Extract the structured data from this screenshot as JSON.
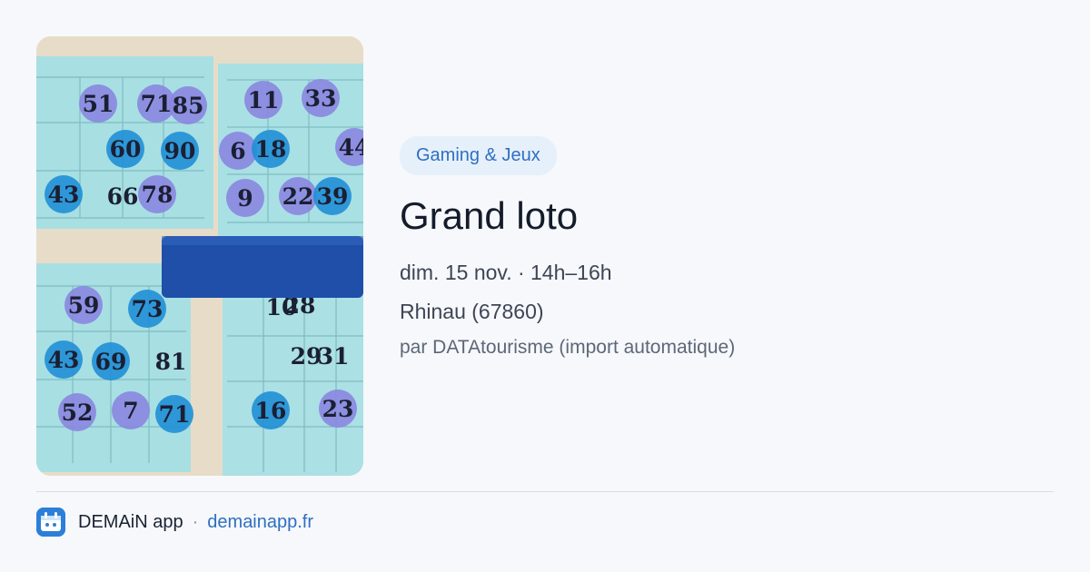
{
  "event": {
    "category": "Gaming & Jeux",
    "title": "Grand loto",
    "date": "dim. 15 nov. · 14h–16h",
    "place": "Rhinau (67860)",
    "source": "par DATAtourisme (import automatique)"
  },
  "photo": {
    "card_numbers": [
      "51",
      "71",
      "85",
      "11",
      "33",
      "60",
      "90",
      "6",
      "18",
      "44",
      "43",
      "66",
      "78",
      "9",
      "22",
      "39",
      "59",
      "73",
      "10",
      "28",
      "43",
      "69",
      "81",
      "29",
      "31",
      "52",
      "7",
      "71",
      "16",
      "23"
    ]
  },
  "footer": {
    "app_name": "DEMAiN app",
    "separator": "·",
    "domain": "demainapp.fr"
  },
  "colors": {
    "accent": "#2f6fc1",
    "category_bg": "#e6f0fb",
    "card_bg": "#a9dfe3",
    "token_purple": "#8a86e0",
    "token_blue": "#1f8fd6",
    "paddle": "#1f4fa8"
  }
}
